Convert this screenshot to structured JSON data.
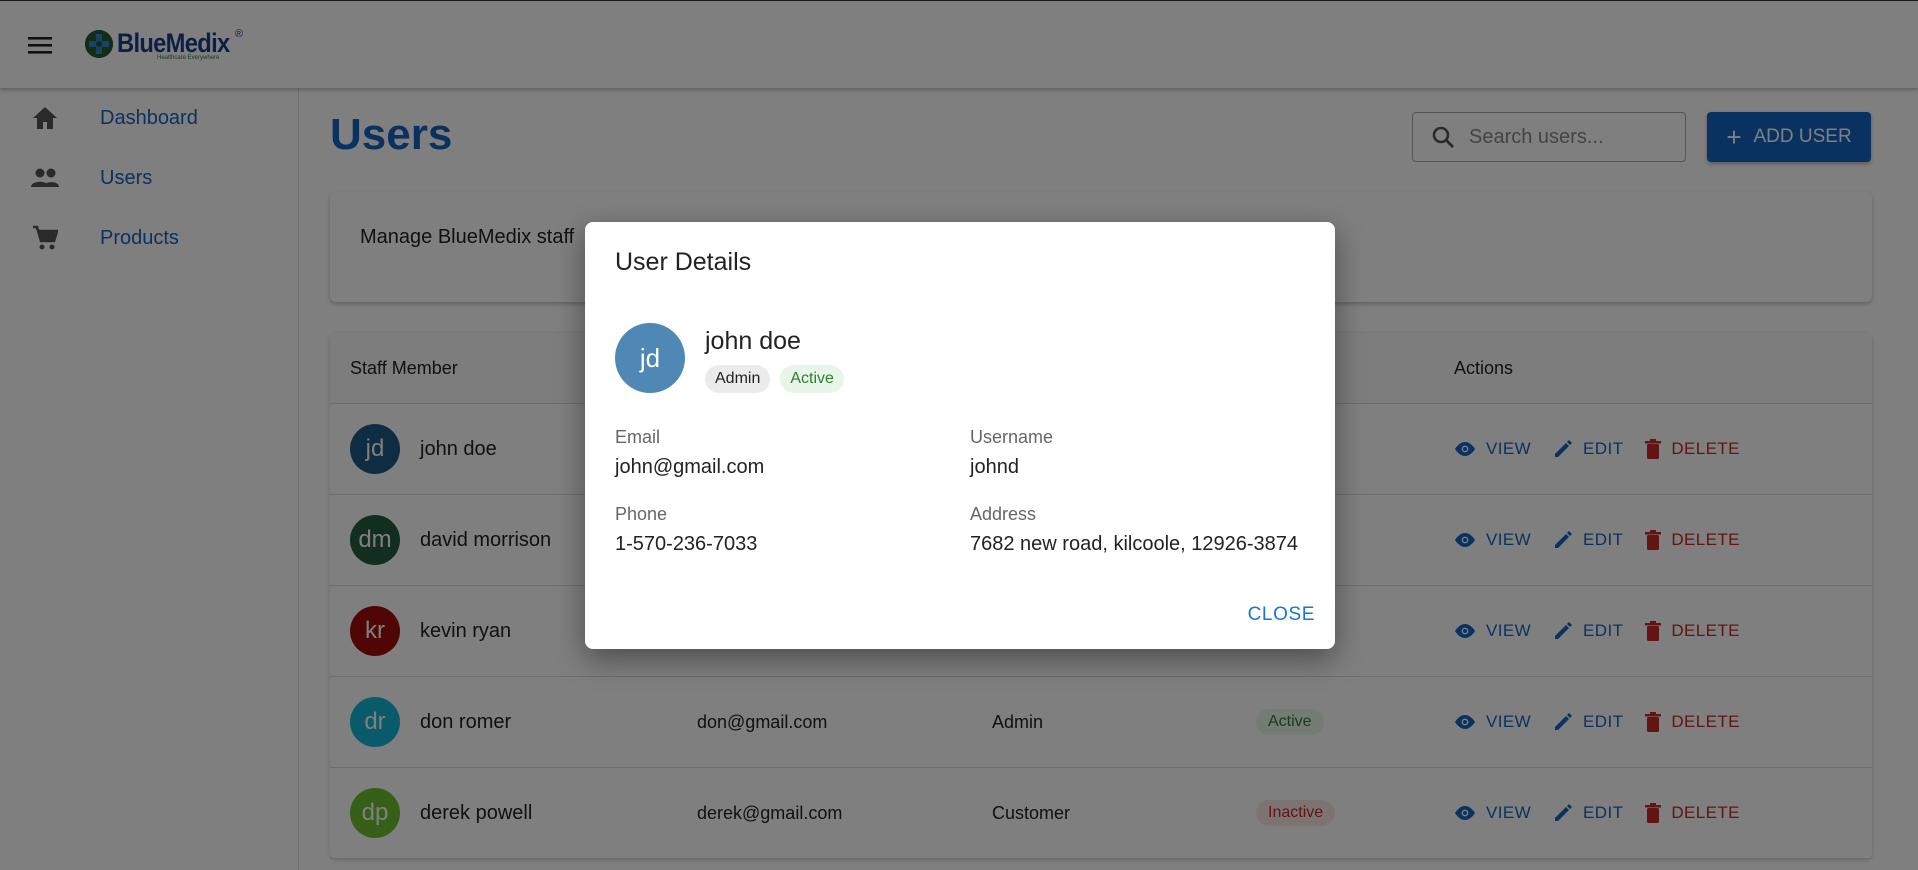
{
  "app": {
    "logo_name": "BlueMedix",
    "logo_registered": "®",
    "logo_tagline": "Healthcare Everywhere"
  },
  "sidebar": {
    "items": [
      {
        "label": "Dashboard",
        "icon": "home-icon"
      },
      {
        "label": "Users",
        "icon": "people-icon"
      },
      {
        "label": "Products",
        "icon": "cart-icon"
      }
    ]
  },
  "main": {
    "title": "Users",
    "search_placeholder": "Search users...",
    "add_label": "ADD USER",
    "description": "Manage BlueMedix staff"
  },
  "table": {
    "headers": {
      "member": "Staff Member",
      "actions": "Actions"
    },
    "actions": {
      "view": "VIEW",
      "edit": "EDIT",
      "delete": "DELETE"
    },
    "rows": [
      {
        "initials": "jd",
        "name": "john doe",
        "email": "",
        "role": "",
        "status": "",
        "avatar_color": "#1f5b84"
      },
      {
        "initials": "dm",
        "name": "david morrison",
        "email": "",
        "role": "",
        "status": "",
        "avatar_color": "#245c3c"
      },
      {
        "initials": "kr",
        "name": "kevin ryan",
        "email": "",
        "role": "",
        "status": "",
        "avatar_color": "#a30c0c"
      },
      {
        "initials": "dr",
        "name": "don romer",
        "email": "don@gmail.com",
        "role": "Admin",
        "status": "Active",
        "avatar_color": "#12b7d6"
      },
      {
        "initials": "dp",
        "name": "derek powell",
        "email": "derek@gmail.com",
        "role": "Customer",
        "status": "Inactive",
        "avatar_color": "#6cbf2e"
      }
    ]
  },
  "dialog": {
    "title": "User Details",
    "initials": "jd",
    "name": "john doe",
    "role_chip": "Admin",
    "status_chip": "Active",
    "email_label": "Email",
    "email": "john@gmail.com",
    "username_label": "Username",
    "username": "johnd",
    "phone_label": "Phone",
    "phone": "1-570-236-7033",
    "address_label": "Address",
    "address": "7682 new road, kilcoole, 12926-3874",
    "close_label": "CLOSE"
  },
  "colors": {
    "primary": "#1565c0",
    "delete": "#c62828",
    "active_bg": "#e8f5e9",
    "active_text": "#2e7d32",
    "inactive_bg": "#fde7e7",
    "inactive_text": "#c62828"
  }
}
